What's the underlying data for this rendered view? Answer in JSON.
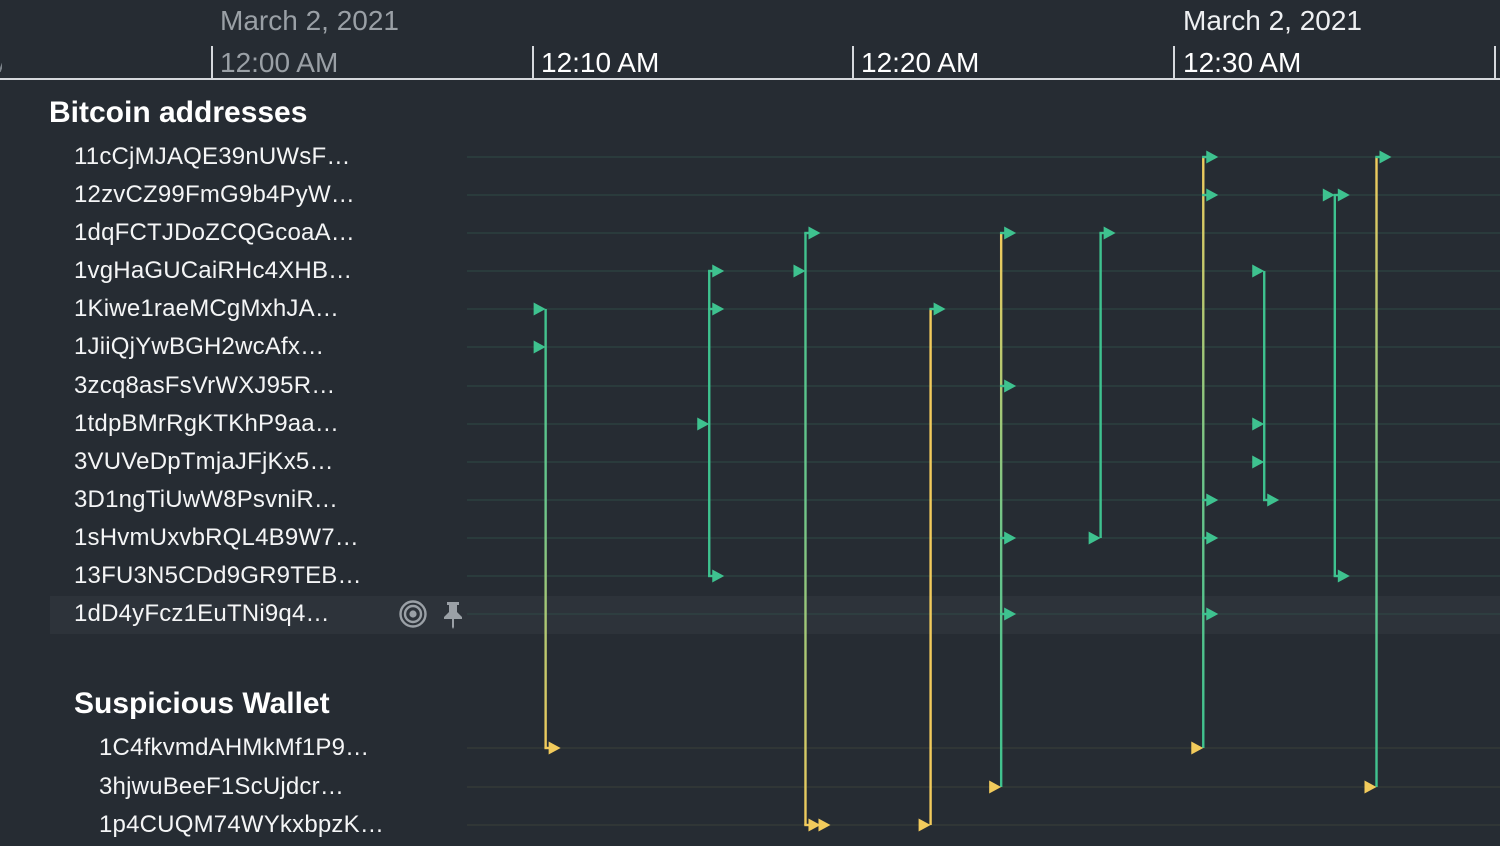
{
  "header": {
    "date_left": "March 2, 2021",
    "date_right": "March 2, 2021",
    "cut_label": "M",
    "ticks": [
      "12:00 AM",
      "12:10 AM",
      "12:20 AM",
      "12:30 AM"
    ]
  },
  "groups": [
    {
      "title": "Bitcoin addresses",
      "rows": [
        "11cCjMJAQE39nUWsF…",
        "12zvCZ99FmG9b4PyW…",
        "1dqFCTJDoZCQGcoaA…",
        "1vgHaGUCaiRHc4XHB…",
        "1Kiwe1raeMCgMxhJA…",
        "1JiiQjYwBGH2wcAfx…",
        "3zcq8asFsVrWXJ95R…",
        "1tdpBMrRgKTKhP9aa…",
        "3VUVeDpTmjaJFjKx5…",
        "3D1ngTiUwW8PsvniR…",
        "1sHvmUxvbRQL4B9W7…",
        "13FU3N5CDd9GR9TEB…",
        "1dD4yFcz1EuTNi9q4…"
      ]
    },
    {
      "title": "Suspicious Wallet",
      "rows": [
        "1C4fkvmdAHMkMf1P9…",
        "3hjwuBeeF1ScUjdcr…",
        "1p4CUQM74WYkxbpzK…"
      ]
    }
  ],
  "hover_row": {
    "label": "1dD4yFcz1EuTNi9q4…",
    "icons": [
      "target-icon",
      "pin-icon"
    ]
  },
  "colors": {
    "background": "#262c33",
    "green": "#3ec28f",
    "yellow": "#f2cb5c",
    "row_line": "#2f4a45"
  },
  "chart_data": {
    "type": "timeline",
    "x_axis": "time",
    "x_range_minutes": [
      -6.6,
      37.5
    ],
    "transfers": [
      {
        "t": 10.4,
        "from": [
          4,
          5
        ],
        "to": [
          13
        ],
        "color": "yellow"
      },
      {
        "t": 15.5,
        "from": [
          7
        ],
        "to": [
          3,
          4,
          11
        ],
        "color": "green"
      },
      {
        "t": 18.5,
        "from": [
          3
        ],
        "to": [
          2,
          15
        ],
        "color": "mixed"
      },
      {
        "t": 22.4,
        "from": [
          15
        ],
        "to": [
          4
        ],
        "color": "yellow"
      },
      {
        "t": 24.6,
        "from": [
          14
        ],
        "to": [
          2,
          6,
          10,
          12
        ],
        "color": "green"
      },
      {
        "t": 27.7,
        "from": [
          10
        ],
        "to": [
          2
        ],
        "color": "green"
      },
      {
        "t": 30.9,
        "from": [
          13
        ],
        "to": [
          0,
          1,
          9,
          10,
          12
        ],
        "color": "green"
      },
      {
        "t": 32.8,
        "from": [
          3,
          7,
          8
        ],
        "to": [
          9
        ],
        "color": "green"
      },
      {
        "t": 35.0,
        "from": [
          1
        ],
        "to": [
          1,
          11
        ],
        "color": "green"
      },
      {
        "t": 36.3,
        "from": [
          14
        ],
        "to": [
          0
        ],
        "color": "green"
      }
    ]
  }
}
